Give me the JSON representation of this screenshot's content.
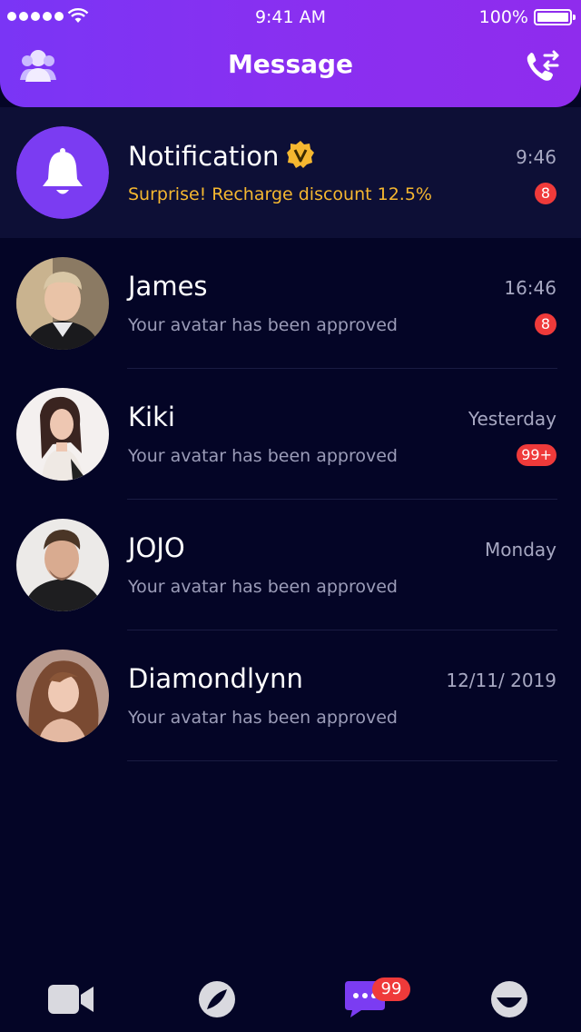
{
  "status_bar": {
    "time": "9:41 AM",
    "battery": "100%"
  },
  "header": {
    "title": "Message",
    "left_icon": "contacts-icon",
    "right_icon": "call-switch-icon"
  },
  "colors": {
    "header_start": "#7a35f5",
    "header_end": "#8f2ced",
    "background": "#040526",
    "badge": "#ef3a3a",
    "promo_text": "#f5b730",
    "verified": "#f5b730"
  },
  "conversations": [
    {
      "name": "Notification",
      "message": "Surprise!  Recharge discount 12.5%",
      "time": "9:46",
      "badge": "8",
      "avatar": "bell-icon",
      "verified": true
    },
    {
      "name": "James",
      "message": "Your avatar has been approved",
      "time": "16:46",
      "badge": "8",
      "avatar": "user-photo"
    },
    {
      "name": "Kiki",
      "message": "Your avatar has been approved",
      "time": "Yesterday",
      "badge": "99+",
      "avatar": "user-photo"
    },
    {
      "name": "JOJO",
      "message": "Your avatar has been approved",
      "time": "Monday",
      "avatar": "user-photo"
    },
    {
      "name": "Diamondlynn",
      "message": "Your avatar has been approved",
      "time": "12/11/ 2019",
      "avatar": "user-photo"
    }
  ],
  "tabbar": {
    "tabs": [
      {
        "icon": "video-camera-icon"
      },
      {
        "icon": "compass-icon"
      },
      {
        "icon": "chat-bubble-icon",
        "badge": "99",
        "active": true
      },
      {
        "icon": "profile-icon"
      }
    ]
  }
}
